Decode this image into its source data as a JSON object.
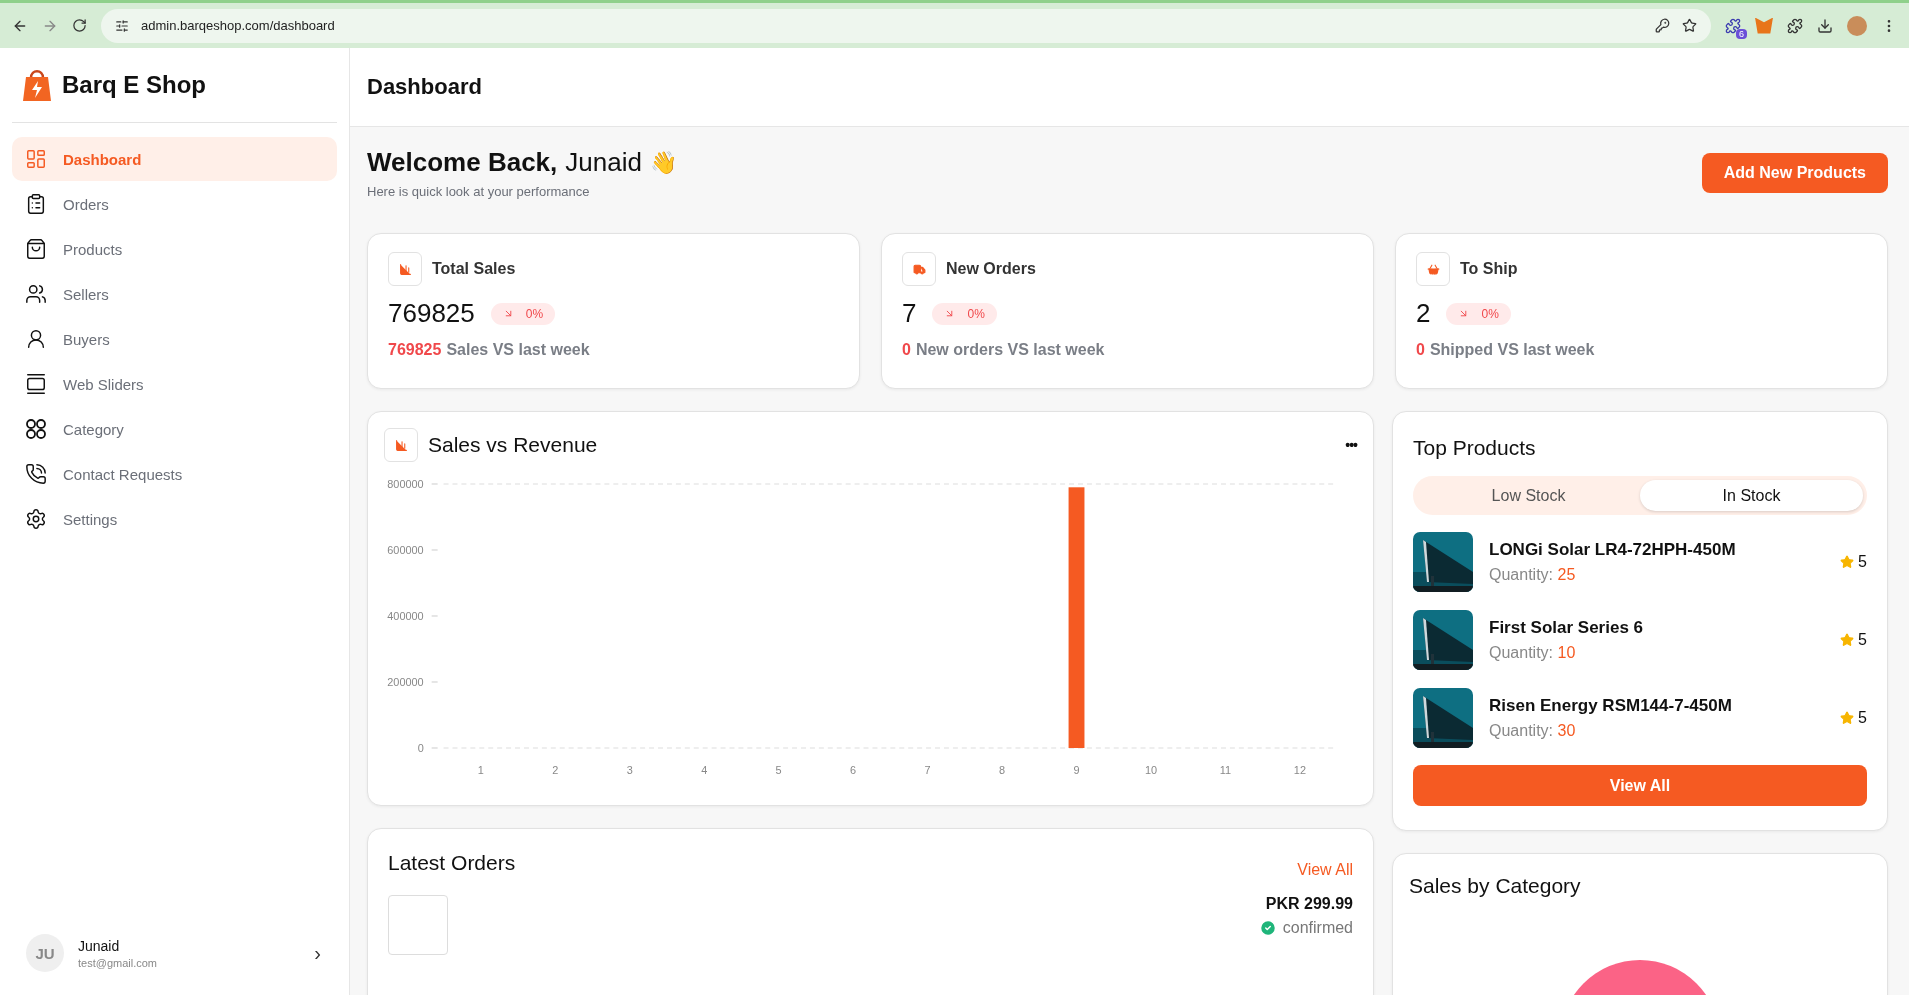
{
  "browser": {
    "url": "admin.barqeshop.com/dashboard",
    "extension_badge": "6"
  },
  "sidebar": {
    "brand": "Barq E Shop",
    "items": [
      {
        "label": "Dashboard",
        "selected": true
      },
      {
        "label": "Orders",
        "selected": false
      },
      {
        "label": "Products",
        "selected": false
      },
      {
        "label": "Sellers",
        "selected": false
      },
      {
        "label": "Buyers",
        "selected": false
      },
      {
        "label": "Web Sliders",
        "selected": false
      },
      {
        "label": "Category",
        "selected": false
      },
      {
        "label": "Contact Requests",
        "selected": false
      },
      {
        "label": "Settings",
        "selected": false
      }
    ],
    "user": {
      "initials": "JU",
      "name": "Junaid",
      "email": "test@gmail.com",
      "chevron": "›"
    }
  },
  "header": {
    "title": "Dashboard"
  },
  "welcome": {
    "greeting": "Welcome Back,",
    "name": "Junaid",
    "emoji": "👋",
    "subtitle": "Here is quick look at your performance",
    "button": "Add New Products"
  },
  "stats": [
    {
      "title": "Total Sales",
      "value": "769825",
      "change": "0%",
      "highlight": "769825",
      "caption": "Sales VS last week"
    },
    {
      "title": "New Orders",
      "value": "7",
      "change": "0%",
      "highlight": "0",
      "caption": "New orders VS last week"
    },
    {
      "title": "To Ship",
      "value": "2",
      "change": "0%",
      "highlight": "0",
      "caption": "Shipped VS last week"
    }
  ],
  "sales_vs_revenue": {
    "title": "Sales vs Revenue",
    "menu": "•••",
    "chart_data": {
      "type": "bar",
      "categories": [
        "1",
        "2",
        "3",
        "4",
        "5",
        "6",
        "7",
        "8",
        "9",
        "10",
        "11",
        "12"
      ],
      "values": [
        0,
        0,
        0,
        0,
        0,
        0,
        0,
        0,
        790000,
        0,
        0,
        0
      ],
      "ylim": [
        0,
        800000
      ],
      "yticks": [
        0,
        200000,
        400000,
        600000,
        800000
      ]
    }
  },
  "top_products": {
    "title": "Top Products",
    "tabs": [
      {
        "label": "Low Stock",
        "selected": false
      },
      {
        "label": "In Stock",
        "selected": true
      }
    ],
    "items": [
      {
        "name": "LONGi Solar LR4-72HPH-450M",
        "quantity_label": "Quantity:",
        "quantity": "25",
        "rating": "5"
      },
      {
        "name": "First Solar Series 6",
        "quantity_label": "Quantity:",
        "quantity": "10",
        "rating": "5"
      },
      {
        "name": "Risen Energy RSM144-7-450M",
        "quantity_label": "Quantity:",
        "quantity": "30",
        "rating": "5"
      }
    ],
    "button": "View All"
  },
  "latest_orders": {
    "title": "Latest Orders",
    "link": "View All",
    "orders": [
      {
        "price": "PKR 299.99",
        "status": "confirmed"
      }
    ]
  },
  "sales_by_category": {
    "title": "Sales by Category"
  }
}
